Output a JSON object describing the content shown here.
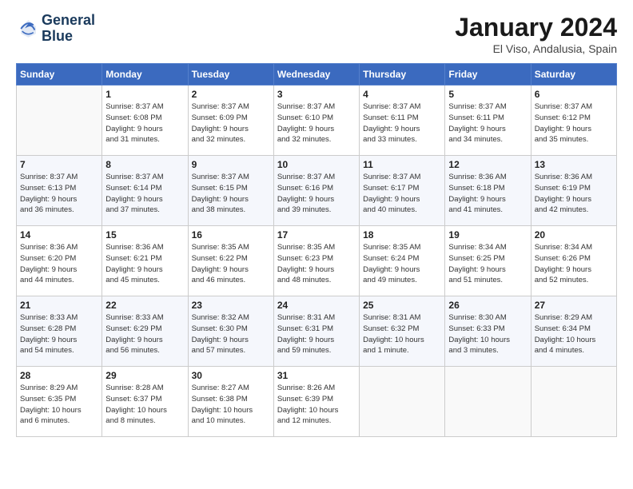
{
  "logo": {
    "line1": "General",
    "line2": "Blue"
  },
  "title": "January 2024",
  "location": "El Viso, Andalusia, Spain",
  "weekdays": [
    "Sunday",
    "Monday",
    "Tuesday",
    "Wednesday",
    "Thursday",
    "Friday",
    "Saturday"
  ],
  "weeks": [
    [
      {
        "day": "",
        "info": ""
      },
      {
        "day": "1",
        "info": "Sunrise: 8:37 AM\nSunset: 6:08 PM\nDaylight: 9 hours\nand 31 minutes."
      },
      {
        "day": "2",
        "info": "Sunrise: 8:37 AM\nSunset: 6:09 PM\nDaylight: 9 hours\nand 32 minutes."
      },
      {
        "day": "3",
        "info": "Sunrise: 8:37 AM\nSunset: 6:10 PM\nDaylight: 9 hours\nand 32 minutes."
      },
      {
        "day": "4",
        "info": "Sunrise: 8:37 AM\nSunset: 6:11 PM\nDaylight: 9 hours\nand 33 minutes."
      },
      {
        "day": "5",
        "info": "Sunrise: 8:37 AM\nSunset: 6:11 PM\nDaylight: 9 hours\nand 34 minutes."
      },
      {
        "day": "6",
        "info": "Sunrise: 8:37 AM\nSunset: 6:12 PM\nDaylight: 9 hours\nand 35 minutes."
      }
    ],
    [
      {
        "day": "7",
        "info": "Sunrise: 8:37 AM\nSunset: 6:13 PM\nDaylight: 9 hours\nand 36 minutes."
      },
      {
        "day": "8",
        "info": "Sunrise: 8:37 AM\nSunset: 6:14 PM\nDaylight: 9 hours\nand 37 minutes."
      },
      {
        "day": "9",
        "info": "Sunrise: 8:37 AM\nSunset: 6:15 PM\nDaylight: 9 hours\nand 38 minutes."
      },
      {
        "day": "10",
        "info": "Sunrise: 8:37 AM\nSunset: 6:16 PM\nDaylight: 9 hours\nand 39 minutes."
      },
      {
        "day": "11",
        "info": "Sunrise: 8:37 AM\nSunset: 6:17 PM\nDaylight: 9 hours\nand 40 minutes."
      },
      {
        "day": "12",
        "info": "Sunrise: 8:36 AM\nSunset: 6:18 PM\nDaylight: 9 hours\nand 41 minutes."
      },
      {
        "day": "13",
        "info": "Sunrise: 8:36 AM\nSunset: 6:19 PM\nDaylight: 9 hours\nand 42 minutes."
      }
    ],
    [
      {
        "day": "14",
        "info": "Sunrise: 8:36 AM\nSunset: 6:20 PM\nDaylight: 9 hours\nand 44 minutes."
      },
      {
        "day": "15",
        "info": "Sunrise: 8:36 AM\nSunset: 6:21 PM\nDaylight: 9 hours\nand 45 minutes."
      },
      {
        "day": "16",
        "info": "Sunrise: 8:35 AM\nSunset: 6:22 PM\nDaylight: 9 hours\nand 46 minutes."
      },
      {
        "day": "17",
        "info": "Sunrise: 8:35 AM\nSunset: 6:23 PM\nDaylight: 9 hours\nand 48 minutes."
      },
      {
        "day": "18",
        "info": "Sunrise: 8:35 AM\nSunset: 6:24 PM\nDaylight: 9 hours\nand 49 minutes."
      },
      {
        "day": "19",
        "info": "Sunrise: 8:34 AM\nSunset: 6:25 PM\nDaylight: 9 hours\nand 51 minutes."
      },
      {
        "day": "20",
        "info": "Sunrise: 8:34 AM\nSunset: 6:26 PM\nDaylight: 9 hours\nand 52 minutes."
      }
    ],
    [
      {
        "day": "21",
        "info": "Sunrise: 8:33 AM\nSunset: 6:28 PM\nDaylight: 9 hours\nand 54 minutes."
      },
      {
        "day": "22",
        "info": "Sunrise: 8:33 AM\nSunset: 6:29 PM\nDaylight: 9 hours\nand 56 minutes."
      },
      {
        "day": "23",
        "info": "Sunrise: 8:32 AM\nSunset: 6:30 PM\nDaylight: 9 hours\nand 57 minutes."
      },
      {
        "day": "24",
        "info": "Sunrise: 8:31 AM\nSunset: 6:31 PM\nDaylight: 9 hours\nand 59 minutes."
      },
      {
        "day": "25",
        "info": "Sunrise: 8:31 AM\nSunset: 6:32 PM\nDaylight: 10 hours\nand 1 minute."
      },
      {
        "day": "26",
        "info": "Sunrise: 8:30 AM\nSunset: 6:33 PM\nDaylight: 10 hours\nand 3 minutes."
      },
      {
        "day": "27",
        "info": "Sunrise: 8:29 AM\nSunset: 6:34 PM\nDaylight: 10 hours\nand 4 minutes."
      }
    ],
    [
      {
        "day": "28",
        "info": "Sunrise: 8:29 AM\nSunset: 6:35 PM\nDaylight: 10 hours\nand 6 minutes."
      },
      {
        "day": "29",
        "info": "Sunrise: 8:28 AM\nSunset: 6:37 PM\nDaylight: 10 hours\nand 8 minutes."
      },
      {
        "day": "30",
        "info": "Sunrise: 8:27 AM\nSunset: 6:38 PM\nDaylight: 10 hours\nand 10 minutes."
      },
      {
        "day": "31",
        "info": "Sunrise: 8:26 AM\nSunset: 6:39 PM\nDaylight: 10 hours\nand 12 minutes."
      },
      {
        "day": "",
        "info": ""
      },
      {
        "day": "",
        "info": ""
      },
      {
        "day": "",
        "info": ""
      }
    ]
  ]
}
